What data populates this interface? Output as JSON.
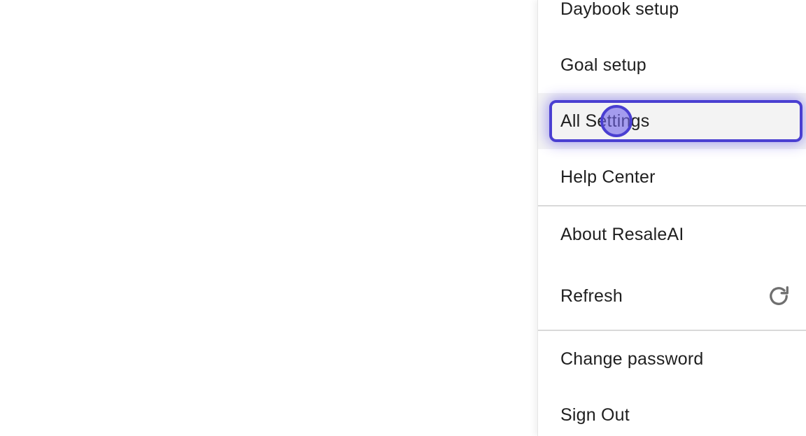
{
  "menu": {
    "items": [
      {
        "label": "Daybook setup"
      },
      {
        "label": "Goal setup"
      },
      {
        "label": "All Settings"
      },
      {
        "label": "Help Center"
      },
      {
        "label": "About ResaleAI"
      },
      {
        "label": "Refresh",
        "icon": "refresh-icon"
      },
      {
        "label": "Change password"
      },
      {
        "label": "Sign Out"
      }
    ],
    "hovered_item": "All Settings"
  },
  "colors": {
    "focus_ring": "#4a3fd1",
    "hover_background": "#f3f3f3",
    "text": "#1f1f1f",
    "divider": "#d9d9d9"
  }
}
